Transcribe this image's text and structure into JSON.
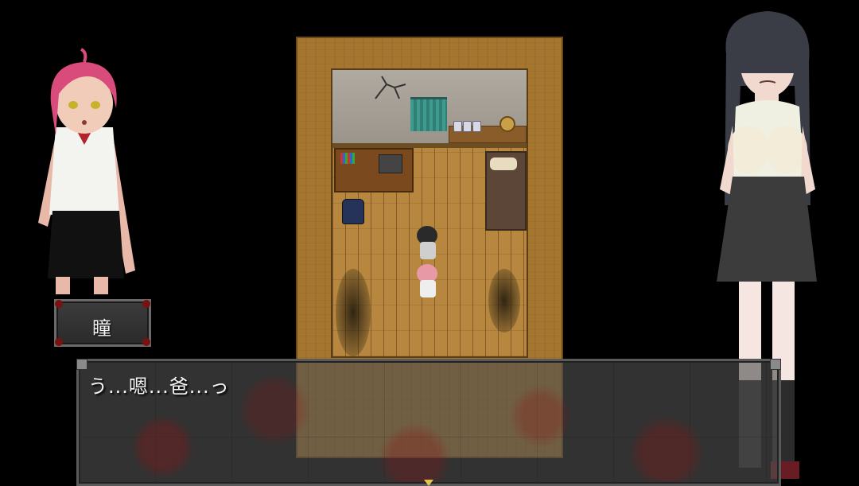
{
  "speaker": {
    "name": "瞳"
  },
  "message": {
    "text": "う...嗯...爸...っ"
  },
  "colors": {
    "background": "#000000",
    "room_frame": "#a5762f",
    "floor": "#b7873f",
    "wall": "#b0aaa0",
    "curtain": "#3f9b8e",
    "blood": "#7a1010",
    "text": "#f4f4f4"
  },
  "icons": {
    "message_continue": "triangle-down-icon"
  }
}
